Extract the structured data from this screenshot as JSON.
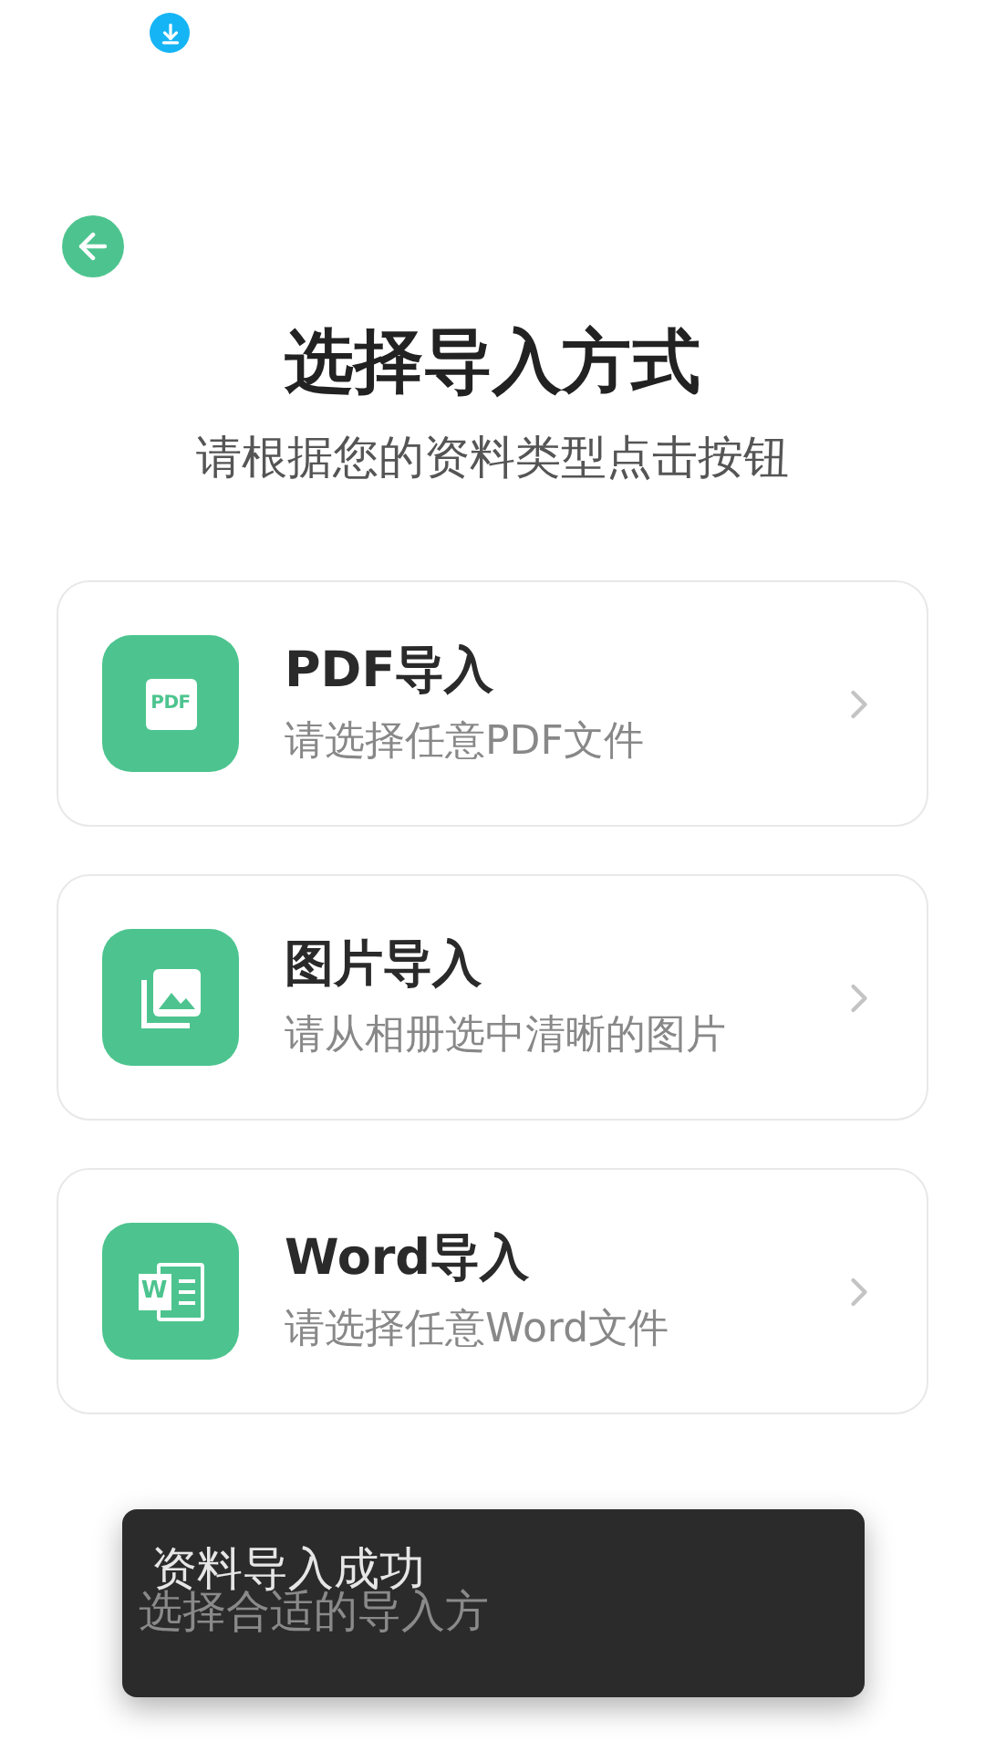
{
  "title": "选择导入方式",
  "subtitle": "请根据您的资料类型点击按钮",
  "options": [
    {
      "kind": "pdf",
      "title": "PDF导入",
      "description": "请选择任意PDF文件",
      "icon_text": "PDF"
    },
    {
      "kind": "image",
      "title": "图片导入",
      "description": "请从相册选中清晰的图片"
    },
    {
      "kind": "word",
      "title": "Word导入",
      "description": "请选择任意Word文件",
      "icon_text": "W"
    }
  ],
  "footer_text": "选择合适的导入方",
  "toast": "资料导入成功"
}
